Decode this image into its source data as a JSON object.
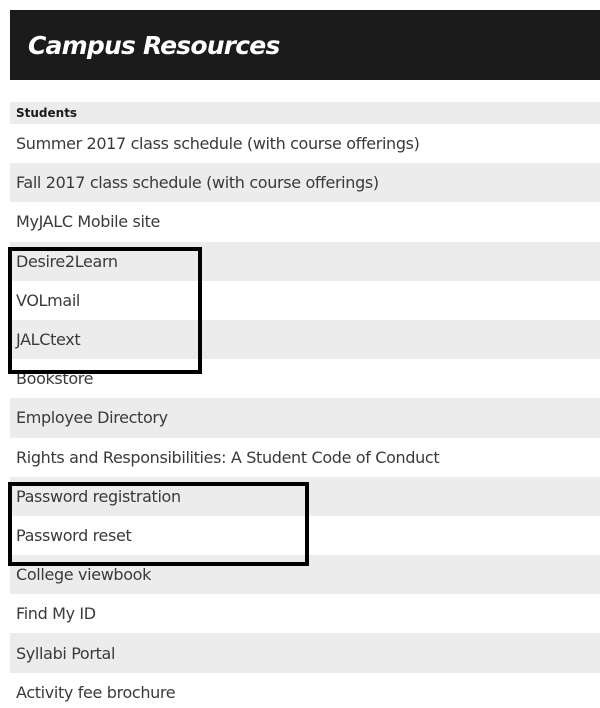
{
  "header": {
    "title": "Campus Resources"
  },
  "section": {
    "title": "Students"
  },
  "links": [
    {
      "label": "Summer 2017 class schedule (with course offerings)"
    },
    {
      "label": "Fall 2017 class schedule (with course offerings)"
    },
    {
      "label": "MyJALC Mobile site"
    },
    {
      "label": "Desire2Learn"
    },
    {
      "label": "VOLmail"
    },
    {
      "label": "JALCtext"
    },
    {
      "label": "Bookstore"
    },
    {
      "label": "Employee Directory"
    },
    {
      "label": "Rights and Responsibilities: A Student Code of Conduct"
    },
    {
      "label": "Password registration"
    },
    {
      "label": "Password reset"
    },
    {
      "label": "College viewbook"
    },
    {
      "label": "Find My ID"
    },
    {
      "label": "Syllabi Portal"
    },
    {
      "label": "Activity fee brochure"
    }
  ]
}
